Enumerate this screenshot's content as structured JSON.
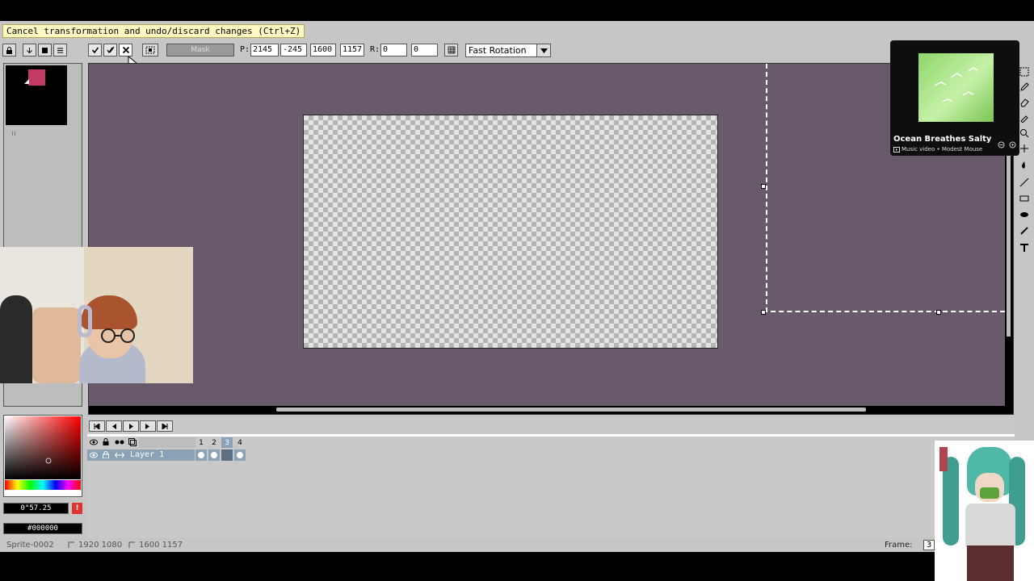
{
  "tooltip": "Cancel transformation and undo/discard changes (Ctrl+Z)",
  "context_bar": {
    "mask_label": "Mask",
    "pos_label": "P:",
    "x": "2145",
    "y": "-245",
    "w": "1600",
    "h": "1157",
    "rot_label": "R:",
    "angle": "0",
    "skew": "0",
    "rotation_mode": "Fast Rotation"
  },
  "music": {
    "title": "Ocean Breathes Salty",
    "subtitle": "Music video • Modest Mouse"
  },
  "color": {
    "angle_value": "0°57.25",
    "hex": "#000000",
    "primary": "#c23b64"
  },
  "timeline": {
    "frames": [
      "1",
      "2",
      "3",
      "4"
    ],
    "layer_name": "Layer 1",
    "frame_label": "Frame:",
    "frame_value": "3"
  },
  "status": {
    "sprite": "Sprite-0002",
    "canvas_size": "1920 1080",
    "selection_size": "1600 1157"
  }
}
